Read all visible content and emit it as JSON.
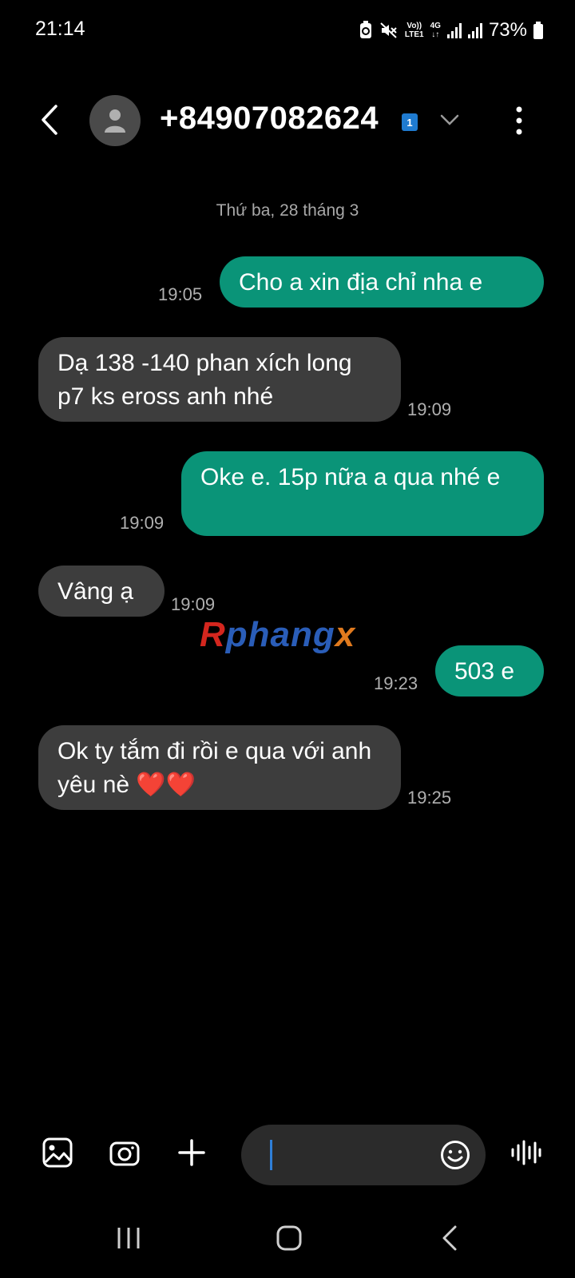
{
  "status_bar": {
    "time": "21:14",
    "volte_top": "Vo))",
    "volte_bottom": "LTE1",
    "network_top": "4G",
    "network_bottom": "↓↑",
    "battery": "73%"
  },
  "header": {
    "contact": "+84907082624",
    "sim_badge": "1"
  },
  "conversation": {
    "date": "Thứ ba, 28 tháng 3",
    "messages": [
      {
        "direction": "sent",
        "text": "Cho a xin địa chỉ nha e",
        "time": "19:05"
      },
      {
        "direction": "received",
        "text": "Dạ 138 -140 phan xích long p7 ks eross anh nhé",
        "time": "19:09"
      },
      {
        "direction": "sent",
        "text": "Oke e. 15p nữa a qua nhé e",
        "time": "19:09"
      },
      {
        "direction": "received",
        "text": "Vâng ạ",
        "time": "19:09"
      },
      {
        "direction": "sent",
        "text": "503 e",
        "time": "19:23"
      },
      {
        "direction": "received",
        "text": "Ok ty tắm đi rồi e qua với anh yêu nè ❤️❤️",
        "time": "19:25"
      }
    ]
  },
  "watermark": {
    "part1": "R",
    "part2": "phang",
    "part3": "x"
  },
  "composer": {
    "input_value": "",
    "placeholder": ""
  },
  "icons": {
    "back": "back-arrow-icon",
    "avatar": "person-icon",
    "dropdown": "chevron-down-icon",
    "more": "more-vert-icon",
    "gallery": "gallery-icon",
    "camera": "camera-icon",
    "add": "plus-icon",
    "emoji": "emoji-icon",
    "voice": "voice-wave-icon",
    "nav_recents": "recents-icon",
    "nav_home": "home-icon",
    "nav_back": "nav-back-icon"
  },
  "colors": {
    "sent_bubble": "#0a9478",
    "received_bubble": "#3d3d3d",
    "background": "#000000",
    "caret": "#2f7fd8"
  }
}
